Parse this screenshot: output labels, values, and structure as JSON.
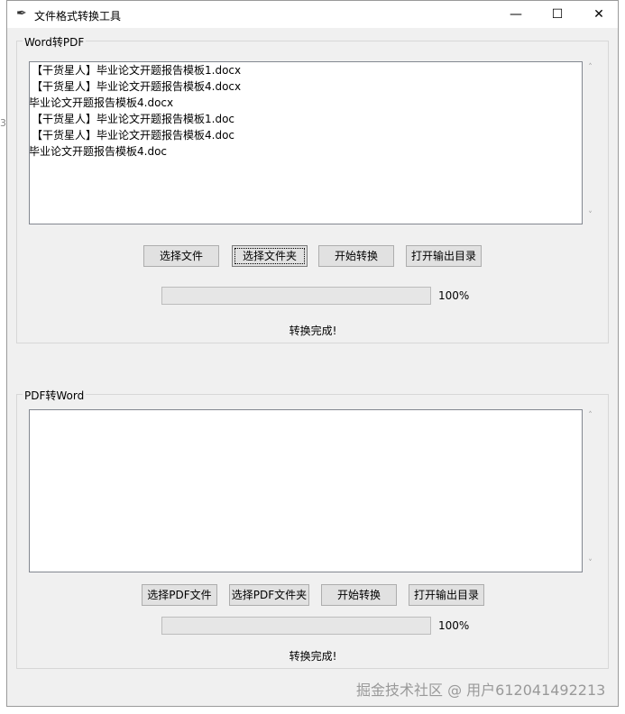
{
  "window": {
    "title": "文件格式转换工具",
    "app_icon": "feather-icon",
    "controls": {
      "minimize": "—",
      "maximize": "☐",
      "close": "✕"
    }
  },
  "outside_mark": "3",
  "word_to_pdf": {
    "label": "Word转PDF",
    "files": [
      "【干货星人】毕业论文开题报告模板1.docx",
      "【干货星人】毕业论文开题报告模板4.docx",
      "毕业论文开题报告模板4.docx",
      "【干货星人】毕业论文开题报告模板1.doc",
      "【干货星人】毕业论文开题报告模板4.doc",
      "毕业论文开题报告模板4.doc"
    ],
    "buttons": {
      "select_file": "选择文件",
      "select_folder": "选择文件夹",
      "start": "开始转换",
      "open_output": "打开输出目录"
    },
    "progress_value": 1.0,
    "progress_text": "100%",
    "status": "转换完成!"
  },
  "pdf_to_word": {
    "label": "PDF转Word",
    "files": [],
    "buttons": {
      "select_file": "选择PDF文件",
      "select_folder": "选择PDF文件夹",
      "start": "开始转换",
      "open_output": "打开输出目录"
    },
    "progress_value": 1.0,
    "progress_text": "100%",
    "status": "转换完成!"
  },
  "watermark": "掘金技术社区 @ 用户612041492213"
}
